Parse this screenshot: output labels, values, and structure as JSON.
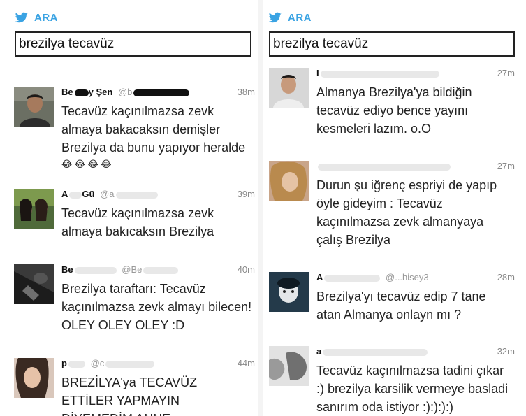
{
  "header": {
    "title": "ARA"
  },
  "search": {
    "query": "brezilya tecavüz"
  },
  "left_tweets": [
    {
      "name": "Be",
      "name_tail": "y Şen",
      "handle": "@b",
      "time": "38m",
      "text": "Tecavüz kaçınılmazsa zevk almaya bakacaksın demişler Brezilya da bunu yapıyor heralde",
      "emoji": "😂 😂 😂 😂"
    },
    {
      "name": "A",
      "name_tail": "Gü",
      "handle": "@a",
      "time": "39m",
      "text": "Tecavüz kaçınılmazsa zevk almaya bakıcaksın Brezilya"
    },
    {
      "name": "Be",
      "handle": "@Be",
      "time": "40m",
      "text": "Brezilya taraftarı: Tecavüz kaçınılmazsa zevk almayı bilecen! OLEY OLEY OLEY :D"
    },
    {
      "name": "p",
      "handle": "@c",
      "time": "44m",
      "text": "BREZİLYA'ya TECAVÜZ ETTİLER YAPMAYIN DİYEMEDİM ANNE"
    }
  ],
  "right_tweets": [
    {
      "name": "I",
      "handle": "",
      "time": "27m",
      "text": "Almanya Brezilya'ya bildiğin tecavüz ediyo bence yayını kesmeleri lazım. o.O"
    },
    {
      "name": "",
      "handle": "",
      "time": "27m",
      "text": "Durun şu iğrenç espriyi de yapıp öyle gideyim : Tecavüz kaçınılmazsa zevk almanyaya çalış Brezilya"
    },
    {
      "name": "A",
      "handle": "@...hisey3",
      "time": "28m",
      "text": "Brezilya'yı tecavüz edip 7 tane atan Almanya onlayn mı ?"
    },
    {
      "name": "a",
      "handle": "",
      "time": "32m",
      "text": "Tecavüz kaçınılmazsa tadini çıkar :) brezilya karsilik vermeye basladi sanırım oda istiyor :):):):)"
    }
  ],
  "colors": {
    "accent": "#3aa3e3"
  }
}
